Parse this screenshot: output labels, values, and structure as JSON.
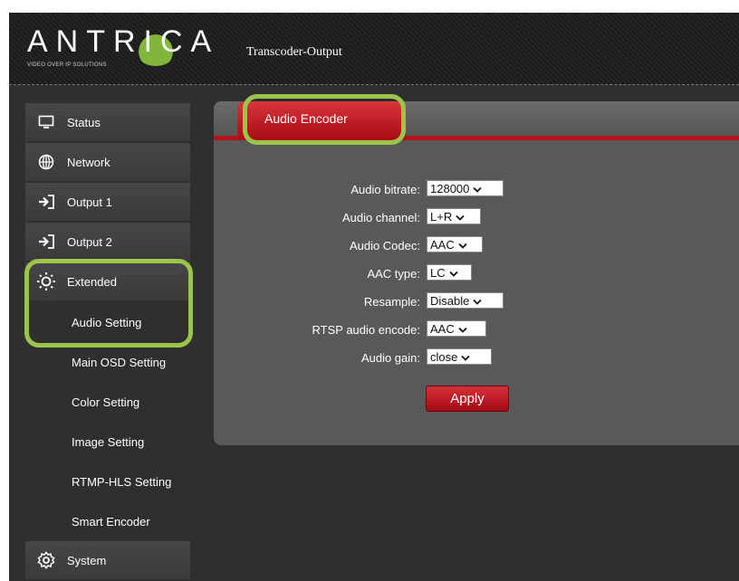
{
  "header": {
    "logo_text": "ANTRICA",
    "logo_tagline": "VIDEO OVER IP SOLUTIONS",
    "page_title": "Transcoder-Output"
  },
  "sidebar": {
    "items": [
      {
        "label": "Status",
        "icon": "monitor-icon"
      },
      {
        "label": "Network",
        "icon": "globe-icon"
      },
      {
        "label": "Output 1",
        "icon": "arrow-in-icon"
      },
      {
        "label": "Output 2",
        "icon": "arrow-in-icon"
      },
      {
        "label": "Extended",
        "icon": "sun-icon"
      }
    ],
    "sub_items": [
      "Audio Setting",
      "Main OSD Setting",
      "Color Setting",
      "Image Setting",
      "RTMP-HLS Setting",
      "Smart Encoder"
    ],
    "system": {
      "label": "System",
      "icon": "gear-icon"
    }
  },
  "tab": {
    "label": "Audio Encoder"
  },
  "form": {
    "rows": [
      {
        "label": "Audio bitrate:",
        "value": "128000"
      },
      {
        "label": "Audio channel:",
        "value": "L+R"
      },
      {
        "label": "Audio Codec:",
        "value": "AAC"
      },
      {
        "label": "AAC type:",
        "value": "LC"
      },
      {
        "label": "Resample:",
        "value": "Disable"
      },
      {
        "label": "RTSP audio encode:",
        "value": "AAC"
      },
      {
        "label": "Audio gain:",
        "value": "close"
      }
    ],
    "apply_label": "Apply"
  },
  "colors": {
    "accent_red": "#b4131c",
    "highlight_green": "#9bc54a",
    "background": "#2f2f2f"
  }
}
